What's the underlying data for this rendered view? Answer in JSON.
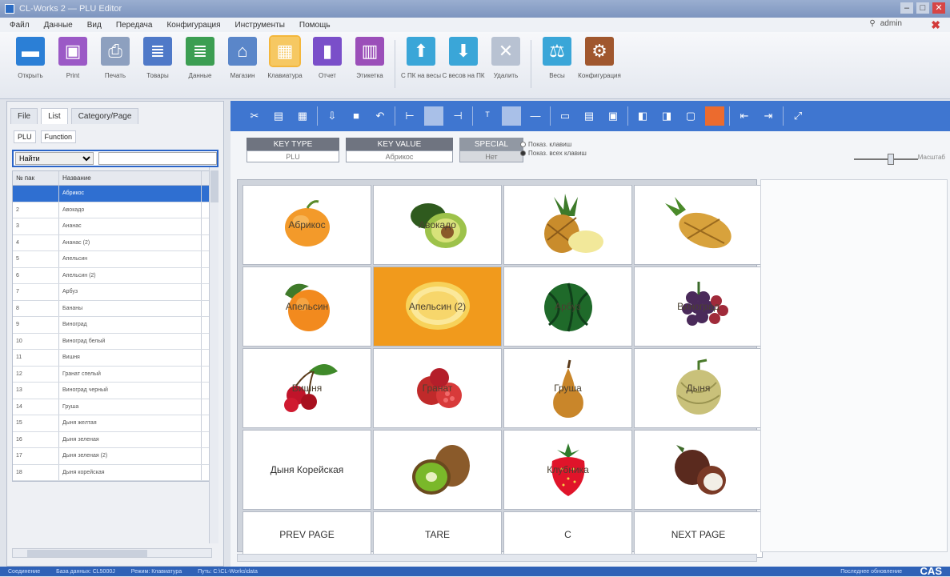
{
  "window": {
    "title": "CL-Works 2 — PLU Editor",
    "user": "admin"
  },
  "menu": [
    "Файл",
    "Данные",
    "Вид",
    "Передача",
    "Конфигурация",
    "Инструменты",
    "Помощь"
  ],
  "ribbon": [
    {
      "label": "Открыть",
      "icon": "folder-icon",
      "color": "#2b7fd6",
      "glyph": "▬"
    },
    {
      "label": "Print",
      "icon": "calendar-icon",
      "color": "#9b59c6",
      "glyph": "▣"
    },
    {
      "label": "Печать",
      "icon": "printer-icon",
      "color": "#8da0bf",
      "glyph": "⎙"
    },
    {
      "label": "Товары",
      "icon": "document-icon",
      "color": "#4f79c8",
      "glyph": "≣"
    },
    {
      "label": "Данные",
      "icon": "document-add-icon",
      "color": "#3c9e52",
      "glyph": "≣"
    },
    {
      "label": "Магазин",
      "icon": "home-icon",
      "color": "#5a86c9",
      "glyph": "⌂"
    },
    {
      "label": "Клавиатура",
      "icon": "keyboard-icon",
      "color": "#3f76d0",
      "glyph": "▦",
      "active": true
    },
    {
      "label": "Отчет",
      "icon": "bar-chart-icon",
      "color": "#7a4fc9",
      "glyph": "▮"
    },
    {
      "label": "Этикетка",
      "icon": "barcode-icon",
      "color": "#9b4fb9",
      "glyph": "▥"
    },
    {
      "label": "С ПК на весы",
      "icon": "scale-upload-icon",
      "color": "#3aa6d8",
      "glyph": "⬆"
    },
    {
      "label": "С весов на ПК",
      "icon": "scale-download-icon",
      "color": "#3aa6d8",
      "glyph": "⬇"
    },
    {
      "label": "Удалить",
      "icon": "scale-delete-icon",
      "color": "#b8c2d2",
      "glyph": "✕"
    },
    {
      "label": "Весы",
      "icon": "scale-icon",
      "color": "#3aa6d8",
      "glyph": "⚖"
    },
    {
      "label": "Конфигурация",
      "icon": "gear-icon",
      "color": "#a0572e",
      "glyph": "⚙"
    }
  ],
  "left": {
    "tabs": [
      "File",
      "List",
      "Category/Page"
    ],
    "subtabs": [
      "PLU",
      "Function"
    ],
    "filter_value": "Найти",
    "filter_placeholder": "",
    "columns": [
      "№ пак",
      "Название"
    ],
    "rows": [
      {
        "no": "",
        "name": "Абрикос",
        "selected": true
      },
      {
        "no": "2",
        "name": "Авокадо"
      },
      {
        "no": "3",
        "name": "Ананас"
      },
      {
        "no": "4",
        "name": "Ананас (2)"
      },
      {
        "no": "5",
        "name": "Апельсин"
      },
      {
        "no": "6",
        "name": "Апельсин (2)"
      },
      {
        "no": "7",
        "name": "Арбуз"
      },
      {
        "no": "8",
        "name": "Бананы"
      },
      {
        "no": "9",
        "name": "Виноград"
      },
      {
        "no": "10",
        "name": "Виноград белый"
      },
      {
        "no": "11",
        "name": "Вишня"
      },
      {
        "no": "12",
        "name": "Гранат спелый"
      },
      {
        "no": "13",
        "name": "Виноград черный"
      },
      {
        "no": "14",
        "name": "Груша"
      },
      {
        "no": "15",
        "name": "Дыня желтая"
      },
      {
        "no": "16",
        "name": "Дыня зеленая"
      },
      {
        "no": "17",
        "name": "Дыня зеленая (2)"
      },
      {
        "no": "18",
        "name": "Дыня корейская"
      }
    ]
  },
  "keyheaders": {
    "key_type_label": "KEY TYPE",
    "key_type_value": "PLU",
    "key_value_label": "KEY VALUE",
    "key_value_value": "Абрикос",
    "third_label": "SPECIAL",
    "third_value": "Нет"
  },
  "radio_options": [
    "Показ. клавиш",
    "Показ. всех клавиш"
  ],
  "zoom_label": "Масштаб",
  "keys": [
    {
      "label": "Абрикос",
      "fruit": "apricot"
    },
    {
      "label": "Авокадо",
      "fruit": "avocado"
    },
    {
      "label": "",
      "fruit": "pineapple-cut"
    },
    {
      "label": "",
      "fruit": "pineapple"
    },
    {
      "label": "Апельсин",
      "fruit": "orange"
    },
    {
      "label": "Апельсин (2)",
      "fruit": "orange-slice",
      "selected": true
    },
    {
      "label": "Арбуз",
      "fruit": "watermelon"
    },
    {
      "label": "Виноград",
      "fruit": "grapes"
    },
    {
      "label": "Вишня",
      "fruit": "cherry"
    },
    {
      "label": "Гранат",
      "fruit": "pomegranate"
    },
    {
      "label": "Груша",
      "fruit": "pear"
    },
    {
      "label": "Дыня",
      "fruit": "melon"
    },
    {
      "label": "Дыня Корейская",
      "fruit": "none"
    },
    {
      "label": "",
      "fruit": "kiwi"
    },
    {
      "label": "Клубника",
      "fruit": "strawberry"
    },
    {
      "label": "",
      "fruit": "lychee"
    },
    {
      "label": "PREV PAGE",
      "fruit": "none"
    },
    {
      "label": "TARE",
      "fruit": "none"
    },
    {
      "label": "C",
      "fruit": "none"
    },
    {
      "label": "NEXT PAGE",
      "fruit": "none"
    }
  ],
  "status": {
    "left": "Соединение",
    "db": "База данных: CL5000J",
    "mode": "Режим: Клавиатура",
    "path": "Путь: C:\\CL-Works\\data",
    "right": "Последнее обновление",
    "brand": "CAS"
  }
}
